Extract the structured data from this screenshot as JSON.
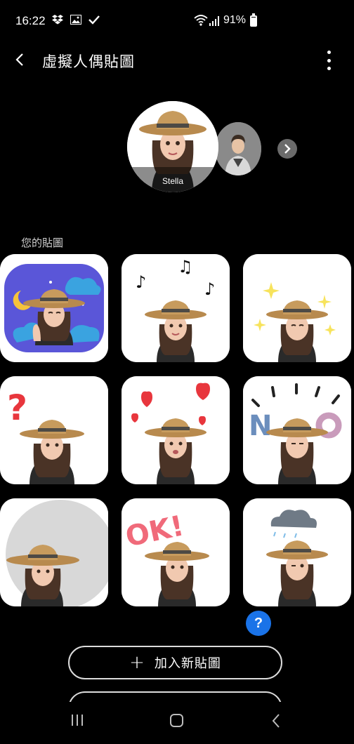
{
  "status_bar": {
    "time": "16:22",
    "battery_percent": "91%",
    "battery_level": 0.91,
    "icons_left": [
      "dropbox-icon",
      "image-icon",
      "check-icon"
    ],
    "icons_right": [
      "wifi-icon",
      "signal-icon",
      "battery-icon"
    ]
  },
  "app_bar": {
    "title": "虛擬人偶貼圖",
    "back_icon": "chevron-left-icon",
    "more_icon": "more-vert-icon"
  },
  "avatars": {
    "selected_name": "Stella",
    "next_icon": "chevron-right-icon"
  },
  "stickers_section": {
    "label": "您的貼圖"
  },
  "stickers": [
    {
      "theme": "night-sky",
      "bg": "#5a56d8"
    },
    {
      "theme": "music-notes",
      "bg": "#ffffff"
    },
    {
      "theme": "sparkles",
      "bg": "#ffffff"
    },
    {
      "theme": "question-mark",
      "bg": "#ffffff"
    },
    {
      "theme": "hearts",
      "bg": "#ffffff"
    },
    {
      "theme": "no",
      "bg": "#ffffff"
    },
    {
      "theme": "grey-circle",
      "bg": "#ffffff"
    },
    {
      "theme": "ok",
      "bg": "#ffffff"
    },
    {
      "theme": "rain-cloud",
      "bg": "#ffffff"
    }
  ],
  "help": {
    "label": "?"
  },
  "add_button": {
    "plus": "+",
    "label": "加入新貼圖"
  },
  "colors": {
    "background": "#000000",
    "accent": "#1a73e8",
    "button_border": "#dcdcdc"
  }
}
